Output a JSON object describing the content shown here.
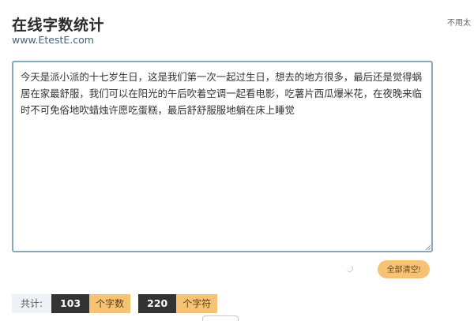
{
  "header": {
    "title": "在线字数统计",
    "url": "www.EtestE.com",
    "side_note": "不用太"
  },
  "editor": {
    "text": "今天是派小派的十七岁生日，这是我们第一次一起过生日，想去的地方很多，最后还是觉得蜗居在家最舒服，我们可以在阳光的午后吹着空调一起看电影，吃薯片西瓜爆米花，在夜晚来临时不可免俗地吹蜡烛许愿吃蛋糕，最后舒舒服服地躺在床上睡觉"
  },
  "actions": {
    "clear_label": "全部清空!"
  },
  "stats": {
    "label": "共计:",
    "char_count": "103",
    "char_unit": "个字数",
    "symbol_count": "220",
    "symbol_unit": "个字符"
  },
  "colors": {
    "accent": "#f6c375",
    "dark": "#333333",
    "border": "#8aa9b6"
  }
}
